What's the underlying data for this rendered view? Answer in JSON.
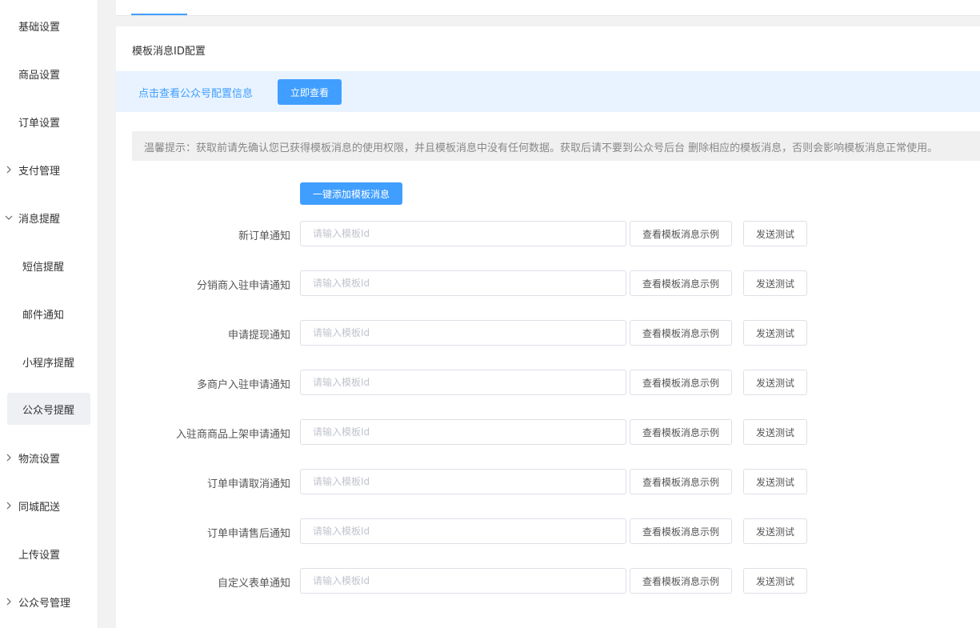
{
  "sidebar": {
    "items": [
      {
        "label": "基础设置",
        "kind": "top",
        "arrow": ""
      },
      {
        "label": "商品设置",
        "kind": "top",
        "arrow": ""
      },
      {
        "label": "订单设置",
        "kind": "top",
        "arrow": ""
      },
      {
        "label": "支付管理",
        "kind": "top",
        "arrow": "chevron-right-icon"
      },
      {
        "label": "消息提醒",
        "kind": "top",
        "arrow": "chevron-down-icon"
      },
      {
        "label": "短信提醒",
        "kind": "sub",
        "arrow": ""
      },
      {
        "label": "邮件通知",
        "kind": "sub",
        "arrow": ""
      },
      {
        "label": "小程序提醒",
        "kind": "sub",
        "arrow": ""
      },
      {
        "label": "公众号提醒",
        "kind": "sub",
        "arrow": "",
        "active": true
      },
      {
        "label": "物流设置",
        "kind": "top",
        "arrow": "chevron-right-icon"
      },
      {
        "label": "同城配送",
        "kind": "top",
        "arrow": "chevron-right-icon"
      },
      {
        "label": "上传设置",
        "kind": "top",
        "arrow": ""
      },
      {
        "label": "公众号管理",
        "kind": "top",
        "arrow": "chevron-right-icon"
      }
    ]
  },
  "panel": {
    "title": "模板消息ID配置",
    "info_link": "点击查看公众号配置信息",
    "view_button": "立即查看",
    "tip": "温馨提示：获取前请先确认您已获得模板消息的使用权限，并且模板消息中没有任何数据。获取后请不要到公众号后台 删除相应的模板消息，否则会影响模板消息正常使用。",
    "add_button": "一键添加模板消息"
  },
  "form": {
    "placeholder": "请输入模板Id",
    "example_button": "查看模板消息示例",
    "test_button": "发送测试",
    "rows": [
      {
        "label": "新订单通知",
        "value": ""
      },
      {
        "label": "分销商入驻申请通知",
        "value": ""
      },
      {
        "label": "申请提现通知",
        "value": ""
      },
      {
        "label": "多商户入驻申请通知",
        "value": ""
      },
      {
        "label": "入驻商商品上架申请通知",
        "value": ""
      },
      {
        "label": "订单申请取消通知",
        "value": ""
      },
      {
        "label": "订单申请售后通知",
        "value": ""
      },
      {
        "label": "自定义表单通知",
        "value": ""
      }
    ]
  },
  "colors": {
    "accent": "#409eff",
    "info_bg": "#e8f3ff",
    "tip_bg": "#f0f0f0",
    "active_nav_bg": "#eef0f3"
  }
}
